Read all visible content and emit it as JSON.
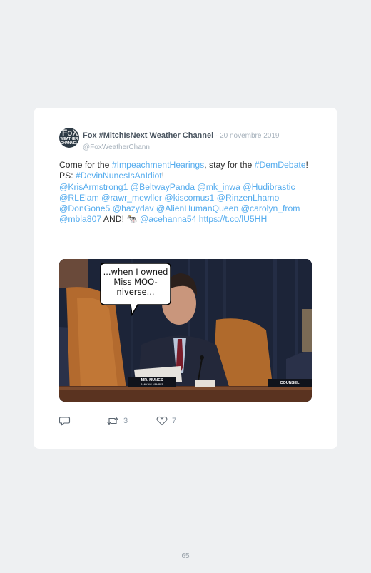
{
  "tweet": {
    "display_name": "Fox #MitchIsNext Weather Channel",
    "separator": " · ",
    "date": "20 novembre 2019",
    "handle": "@FoxWeatherChann",
    "avatar_logo": "FOX WEATHER CHANNEL",
    "text_segments": [
      {
        "t": "Come for the ",
        "link": false
      },
      {
        "t": "#ImpeachmentHearings",
        "link": true
      },
      {
        "t": ", stay for the ",
        "link": false
      },
      {
        "t": "#DemDebate",
        "link": true
      },
      {
        "t": "!",
        "link": false
      },
      {
        "br": true
      },
      {
        "t": "PS: ",
        "link": false
      },
      {
        "t": "#DevinNunesIsAnIdiot",
        "link": true
      },
      {
        "t": "!",
        "link": false
      },
      {
        "br": true
      },
      {
        "t": "@KrisArmstrong1 @BeltwayPanda @mk_inwa @Hudibrastic @RLElam @rawr_mewller @kiscomus1 @RinzenLhamo @DonGone5 @hazydav @AlienHumanQueen @carolyn_from @mbla807",
        "link": true
      },
      {
        "t": " AND! 🐄 ",
        "link": false
      },
      {
        "t": "@acehanna54 https://t.co/lU5HH",
        "link": true
      }
    ],
    "media": {
      "speech_bubble": "...when I owned Miss MOO-niverse...",
      "nameplate": "MR. NUNES",
      "nameplate_sub": "RANKING MEMBER",
      "counsel_plate": "COUNSEL"
    },
    "actions": {
      "reply_icon": "reply-icon",
      "retweet_icon": "retweet-icon",
      "retweet_count": "3",
      "like_icon": "heart-icon",
      "like_count": "7"
    }
  },
  "page_number": "65",
  "colors": {
    "link": "#55acee",
    "background": "#eef0f2",
    "muted": "#a7b2bc"
  }
}
